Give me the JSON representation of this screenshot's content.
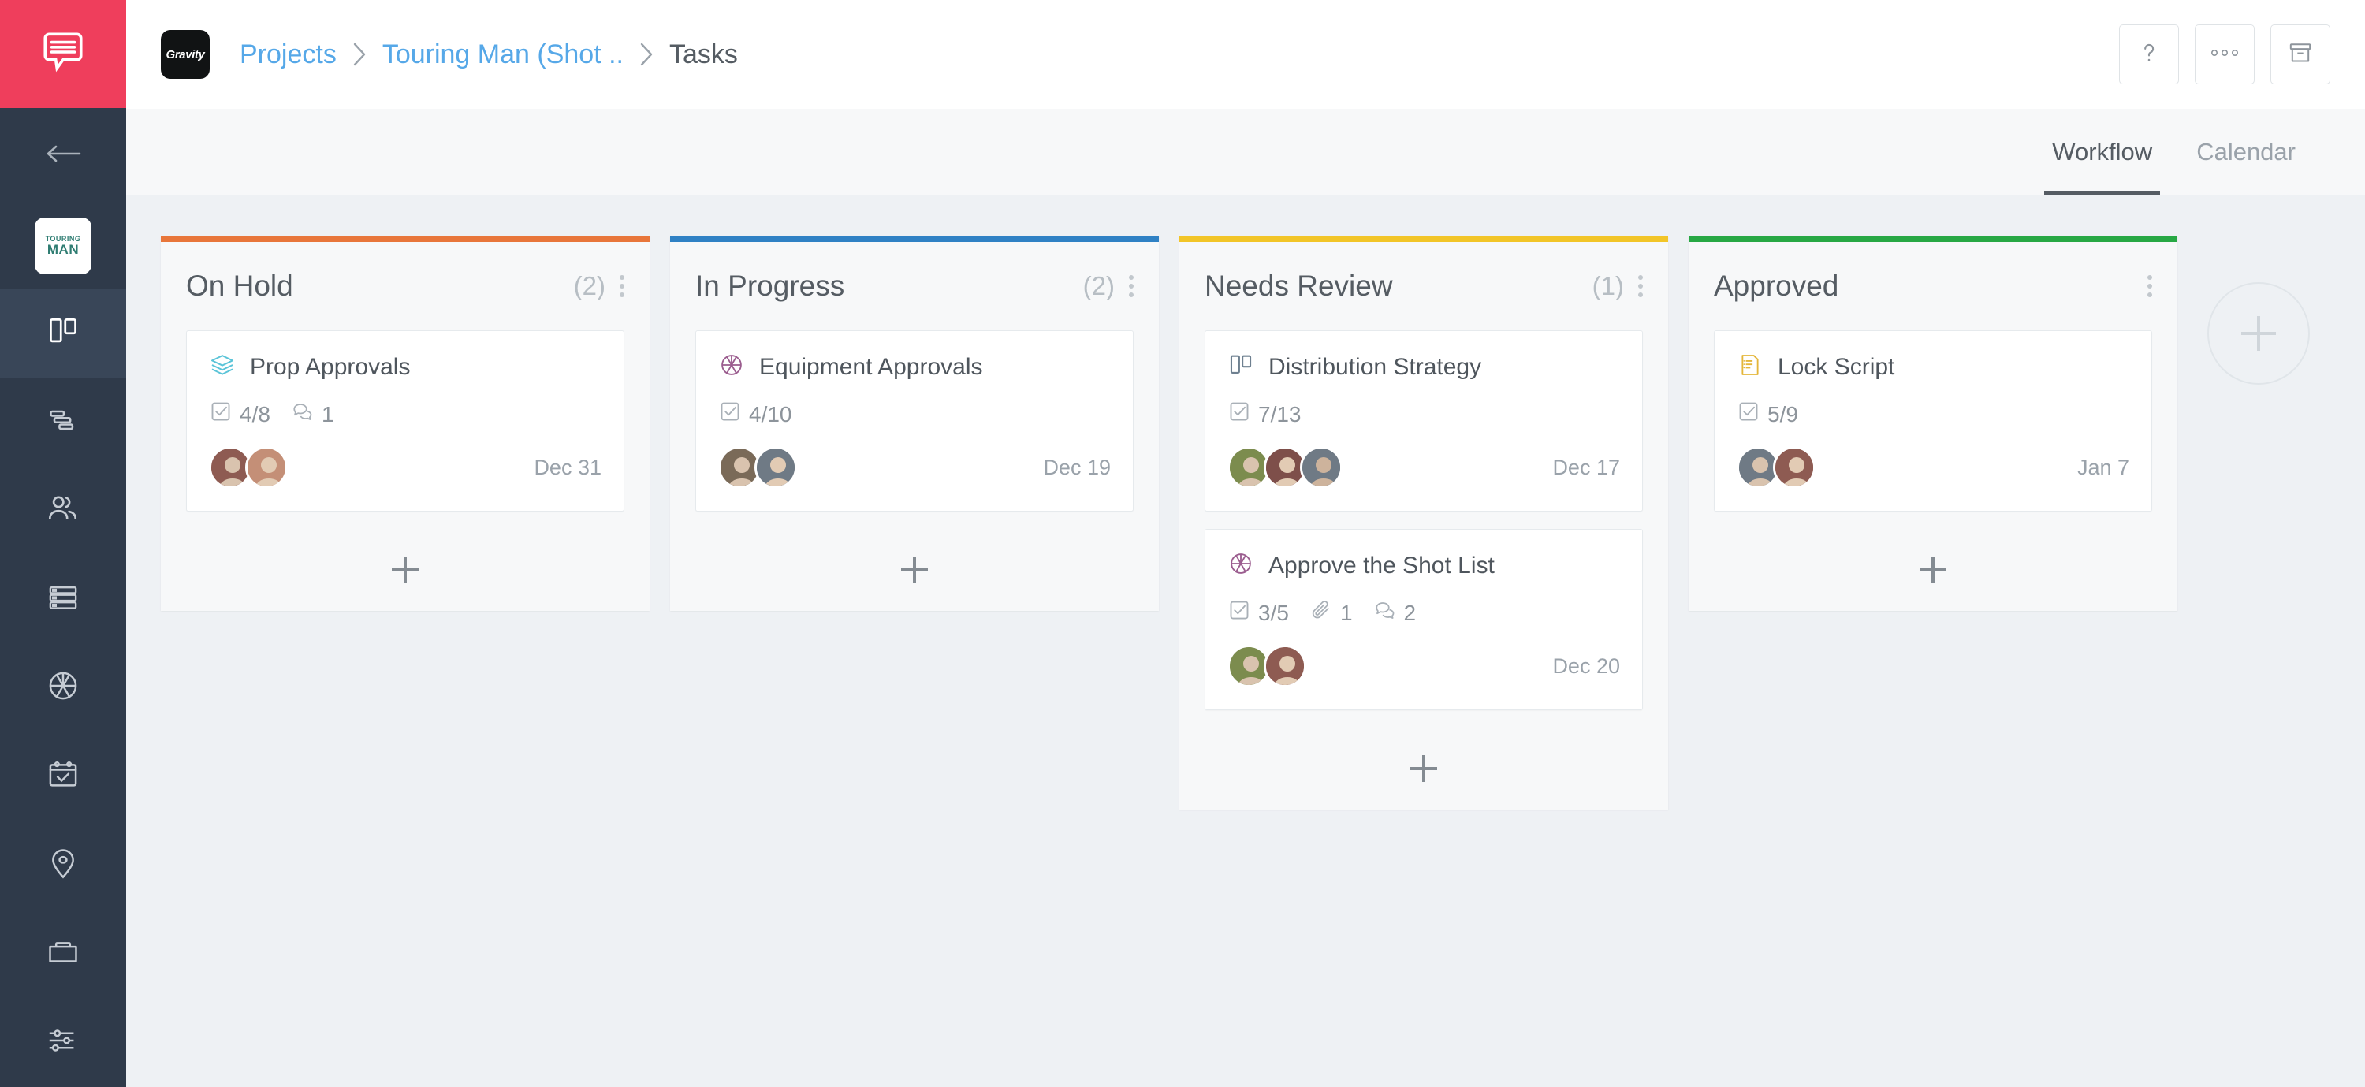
{
  "rail": {
    "app_logo_icon": "speech-bubble-lines-icon",
    "back_icon": "arrow-left-icon",
    "project_logo": {
      "line1": "TOURING",
      "line2": "MAN"
    },
    "items": [
      {
        "name": "board",
        "icon": "board-columns-icon",
        "active": true
      },
      {
        "name": "gantt",
        "icon": "gantt-bars-icon",
        "active": false
      },
      {
        "name": "people",
        "icon": "people-icon",
        "active": false
      },
      {
        "name": "list",
        "icon": "list-rows-icon",
        "active": false
      },
      {
        "name": "shots",
        "icon": "aperture-icon",
        "active": false
      },
      {
        "name": "schedule",
        "icon": "calendar-check-icon",
        "active": false
      },
      {
        "name": "locations",
        "icon": "map-pin-icon",
        "active": false
      },
      {
        "name": "files",
        "icon": "folder-icon",
        "active": false
      },
      {
        "name": "settings",
        "icon": "sliders-icon",
        "active": false
      }
    ]
  },
  "topbar": {
    "brand_label": "Gravity",
    "breadcrumb": [
      {
        "label": "Projects",
        "link": true
      },
      {
        "label": "Touring Man (Shot ..",
        "link": true
      },
      {
        "label": "Tasks",
        "link": false
      }
    ],
    "actions": [
      {
        "name": "help",
        "icon": "question-mark-icon"
      },
      {
        "name": "more",
        "icon": "ellipsis-icon"
      },
      {
        "name": "archive",
        "icon": "archive-box-icon"
      }
    ]
  },
  "tabs": [
    {
      "label": "Workflow",
      "active": true
    },
    {
      "label": "Calendar",
      "active": false
    }
  ],
  "board": {
    "add_column_label": "+",
    "columns": [
      {
        "title": "On Hold",
        "count": "(2)",
        "color": "#e8763a",
        "cards": [
          {
            "title": "Prop Approvals",
            "icon": "layers-icon",
            "icon_color": "#5bc4d8",
            "checklist": "4/8",
            "attachments": null,
            "comments": "1",
            "due": "Dec 31",
            "avatars": [
              "#8e5b52",
              "#c48f77"
            ]
          }
        ]
      },
      {
        "title": "In Progress",
        "count": "(2)",
        "color": "#2f81c4",
        "cards": [
          {
            "title": "Equipment Approvals",
            "icon": "aperture-icon",
            "icon_color": "#9b5d8f",
            "checklist": "4/10",
            "attachments": null,
            "comments": null,
            "due": "Dec 19",
            "avatars": [
              "#7a6a58",
              "#6f7a85"
            ]
          }
        ]
      },
      {
        "title": "Needs Review",
        "count": "(1)",
        "color": "#f2c528",
        "cards": [
          {
            "title": "Distribution Strategy",
            "icon": "board-columns-icon",
            "icon_color": "#6e8090",
            "checklist": "7/13",
            "attachments": null,
            "comments": null,
            "due": "Dec 17",
            "avatars": [
              "#7c8c4e",
              "#7e4f4a",
              "#6f7a85"
            ]
          },
          {
            "title": "Approve the Shot List",
            "icon": "aperture-icon",
            "icon_color": "#9b5d8f",
            "checklist": "3/5",
            "attachments": "1",
            "comments": "2",
            "due": "Dec 20",
            "avatars": [
              "#7c8c4e",
              "#8e5b52"
            ]
          }
        ]
      },
      {
        "title": "Approved",
        "count": "",
        "color": "#27a844",
        "cards": [
          {
            "title": "Lock Script",
            "icon": "script-notepad-icon",
            "icon_color": "#e4b63a",
            "checklist": "5/9",
            "attachments": null,
            "comments": null,
            "due": "Jan 7",
            "avatars": [
              "#6f7a85",
              "#8e5b52"
            ]
          }
        ]
      }
    ]
  }
}
